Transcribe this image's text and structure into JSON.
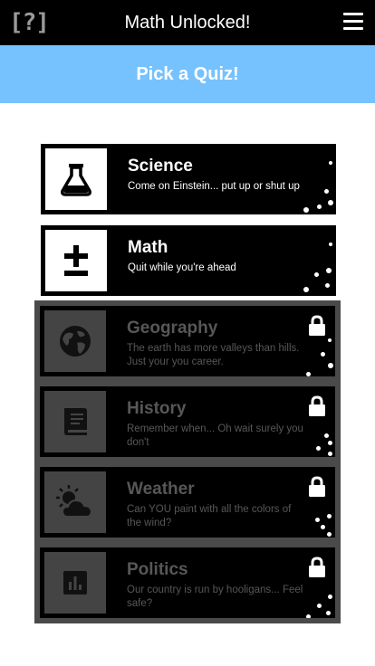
{
  "header": {
    "logo_text": "[?]",
    "title": "Math Unlocked!",
    "menu_icon": "hamburger-menu-icon"
  },
  "banner": {
    "text": "Pick a Quiz!"
  },
  "colors": {
    "header_bg": "#000000",
    "banner_bg": "#76c2ff",
    "card_bg": "#000000",
    "locked_frame": "#4a4a4a",
    "locked_text": "#575757"
  },
  "quizzes": [
    {
      "id": "science",
      "title": "Science",
      "description": "Come on Einstein... put up or shut up",
      "icon": "flask-icon",
      "locked": false
    },
    {
      "id": "math",
      "title": "Math",
      "description": "Quit while you're ahead",
      "icon": "plus-minus-icon",
      "locked": false
    },
    {
      "id": "geography",
      "title": "Geography",
      "description": "The earth has more valleys than hills. Just your you career.",
      "icon": "globe-icon",
      "locked": true
    },
    {
      "id": "history",
      "title": "History",
      "description": "Remember when... Oh wait surely you don't",
      "icon": "book-icon",
      "locked": true
    },
    {
      "id": "weather",
      "title": "Weather",
      "description": "Can YOU paint with all the colors of the wind?",
      "icon": "sun-cloud-icon",
      "locked": true
    },
    {
      "id": "politics",
      "title": "Politics",
      "description": "Our country is run by hooligans... Feel safe?",
      "icon": "bar-chart-icon",
      "locked": true
    }
  ]
}
